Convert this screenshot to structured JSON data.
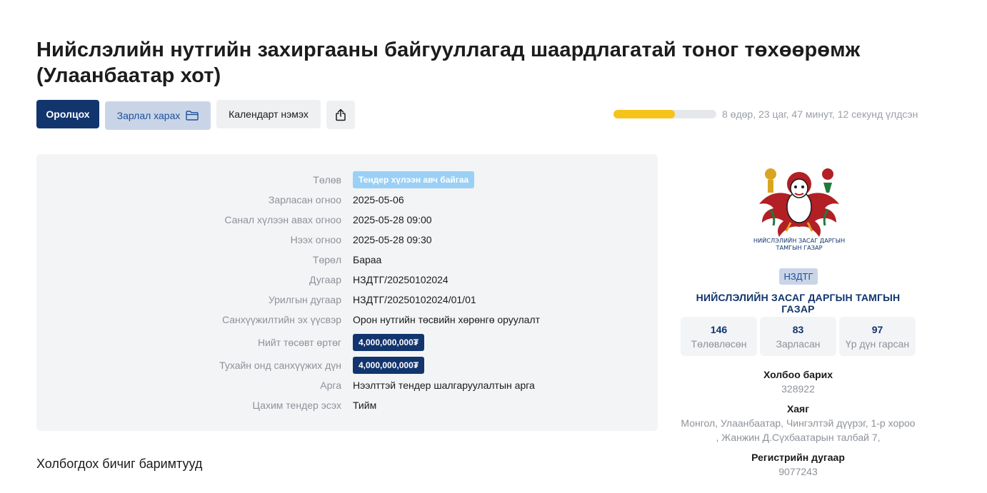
{
  "title": "Нийслэлийн нутгийн захиргааны байгууллагад шаардлагатай тоног төхөөрөмж (Улаанбаатар хот)",
  "actions": {
    "participate": "Оролцох",
    "view_notice": "Зарлал харах",
    "add_calendar": "Календарт нэмэх"
  },
  "progress": {
    "fraction": 0.6,
    "color": "#f6c31b",
    "text": "8 өдөр, 23 цаг, 47 минут, 12 секунд үлдсэн"
  },
  "details": {
    "status_label": "Төлөв",
    "status_value": "Тендер хүлээн авч байгаа",
    "announced_label": "Зарласан огноо",
    "announced_value": "2025-05-06",
    "deadline_label": "Санал хүлээн авах огноо",
    "deadline_value": "2025-05-28 09:00",
    "opening_label": "Нээх огноо",
    "opening_value": "2025-05-28 09:30",
    "type_label": "Төрөл",
    "type_value": "Бараа",
    "number_label": "Дугаар",
    "number_value": "НЗДТГ/20250102024",
    "invitation_label": "Урилгын дугаар",
    "invitation_value": "НЗДТГ/20250102024/01/01",
    "funding_label": "Санхүүжилтийн эх үүсвэр",
    "funding_value": "Орон нутгийн төсвийн хөрөнгө оруулалт",
    "budget_label": "Нийт төсөвт өртөг",
    "budget_value": "4,000,000,000₮",
    "year_funding_label": "Тухайн онд санхүүжих дүн",
    "year_funding_value": "4,000,000,000₮",
    "method_label": "Арга",
    "method_value": "Нээлттэй тендер шалгаруулалтын арга",
    "e_tender_label": "Цахим тендер эсэх",
    "e_tender_value": "Тийм"
  },
  "documents_title": "Холбогдох бичиг баримтууд",
  "organization": {
    "logo_line1": "НИЙСЛЭЛИЙН ЗАСАГ ДАРГЫН",
    "logo_line2": "ТАМГЫН ГАЗАР",
    "abbr": "НЗДТГ",
    "name": "НИЙСЛЭЛИЙН ЗАСАГ ДАРГЫН ТАМГЫН ГАЗАР",
    "stats": [
      {
        "value": "146",
        "label": "Төлөвлөсөн"
      },
      {
        "value": "83",
        "label": "Зарласан"
      },
      {
        "value": "97",
        "label": "Үр дүн гарсан"
      }
    ],
    "contact_label": "Холбоо барих",
    "contact_value": "328922",
    "address_label": "Хаяг",
    "address_line1": "Монгол, Улаанбаатар, Чингэлтэй дүүрэг, 1-р хороо",
    "address_line2": ", Жанжин Д.Сүхбаатарын талбай 7,",
    "register_label": "Регистрийн дугаар",
    "register_value": "9077243"
  },
  "colors": {
    "primary": "#12356e",
    "accent_light": "#c9d5e7",
    "status_badge": "#9ad0f5",
    "panel_bg": "#f3f4f6"
  },
  "icons": {
    "view_notice": "folder-icon",
    "share": "share-icon",
    "logo": "emblem-icon"
  }
}
